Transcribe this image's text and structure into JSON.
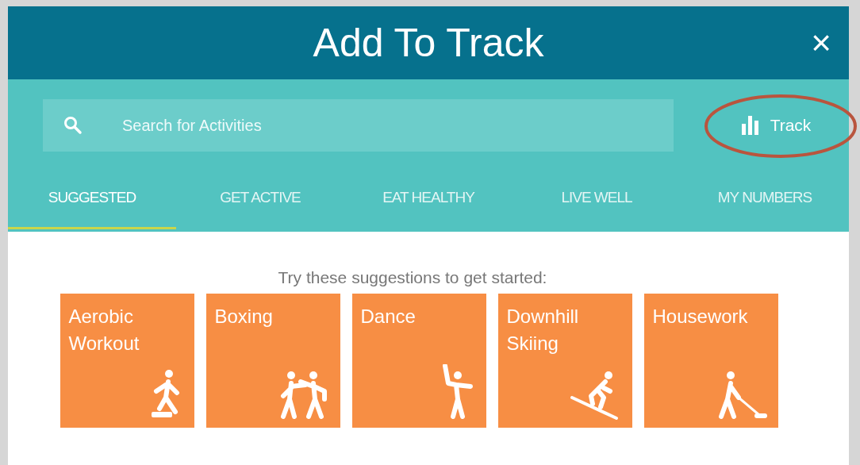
{
  "dialog": {
    "title": "Add To Track",
    "close": "×"
  },
  "search": {
    "placeholder": "Search for Activities"
  },
  "track_button": {
    "label": "Track"
  },
  "tabs": [
    {
      "label": "SUGGESTED",
      "selected": true
    },
    {
      "label": "GET ACTIVE",
      "selected": false
    },
    {
      "label": "EAT HEALTHY",
      "selected": false
    },
    {
      "label": "LIVE WELL",
      "selected": false
    },
    {
      "label": "MY NUMBERS",
      "selected": false
    }
  ],
  "intro": "Try these suggestions to get started:",
  "suggestions": [
    {
      "label": "Aerobic Workout",
      "kind": "aerobic"
    },
    {
      "label": "Boxing",
      "kind": "boxing"
    },
    {
      "label": "Dance",
      "kind": "dance"
    },
    {
      "label": "Downhill Skiing",
      "kind": "skiing"
    },
    {
      "label": "Housework",
      "kind": "housework"
    }
  ]
}
